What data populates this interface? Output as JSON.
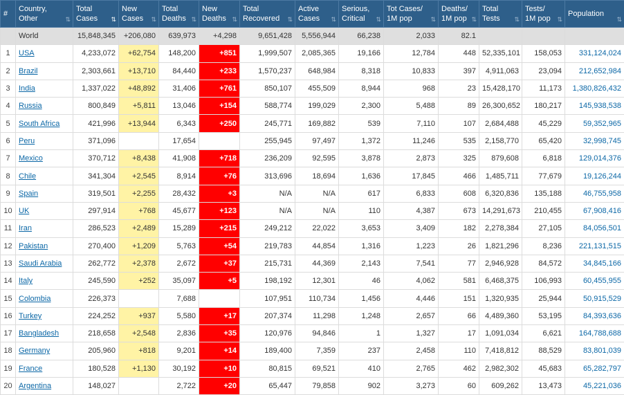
{
  "headers": [
    {
      "l1": "#",
      "l2": ""
    },
    {
      "l1": "Country,",
      "l2": "Other"
    },
    {
      "l1": "Total",
      "l2": "Cases"
    },
    {
      "l1": "New",
      "l2": "Cases"
    },
    {
      "l1": "Total",
      "l2": "Deaths"
    },
    {
      "l1": "New",
      "l2": "Deaths"
    },
    {
      "l1": "Total",
      "l2": "Recovered"
    },
    {
      "l1": "Active",
      "l2": "Cases"
    },
    {
      "l1": "Serious,",
      "l2": "Critical"
    },
    {
      "l1": "Tot Cases/",
      "l2": "1M pop"
    },
    {
      "l1": "Deaths/",
      "l2": "1M pop"
    },
    {
      "l1": "Total",
      "l2": "Tests"
    },
    {
      "l1": "Tests/",
      "l2": "1M pop"
    },
    {
      "l1": "Population",
      "l2": ""
    }
  ],
  "world": {
    "name": "World",
    "total_cases": "15,848,345",
    "new_cases": "+206,080",
    "total_deaths": "639,973",
    "new_deaths": "+4,298",
    "recovered": "9,651,428",
    "active": "5,556,944",
    "critical": "66,238",
    "cases_per_m": "2,033",
    "deaths_per_m": "82.1",
    "tests": "",
    "tests_per_m": "",
    "population": ""
  },
  "rows": [
    {
      "n": "1",
      "name": "USA",
      "total_cases": "4,233,072",
      "new_cases": "+62,754",
      "total_deaths": "148,200",
      "new_deaths": "+851",
      "recovered": "1,999,507",
      "active": "2,085,365",
      "critical": "19,166",
      "cases_per_m": "12,784",
      "deaths_per_m": "448",
      "tests": "52,335,101",
      "tests_per_m": "158,053",
      "population": "331,124,024"
    },
    {
      "n": "2",
      "name": "Brazil",
      "total_cases": "2,303,661",
      "new_cases": "+13,710",
      "total_deaths": "84,440",
      "new_deaths": "+233",
      "recovered": "1,570,237",
      "active": "648,984",
      "critical": "8,318",
      "cases_per_m": "10,833",
      "deaths_per_m": "397",
      "tests": "4,911,063",
      "tests_per_m": "23,094",
      "population": "212,652,984"
    },
    {
      "n": "3",
      "name": "India",
      "total_cases": "1,337,022",
      "new_cases": "+48,892",
      "total_deaths": "31,406",
      "new_deaths": "+761",
      "recovered": "850,107",
      "active": "455,509",
      "critical": "8,944",
      "cases_per_m": "968",
      "deaths_per_m": "23",
      "tests": "15,428,170",
      "tests_per_m": "11,173",
      "population": "1,380,826,432"
    },
    {
      "n": "4",
      "name": "Russia",
      "total_cases": "800,849",
      "new_cases": "+5,811",
      "total_deaths": "13,046",
      "new_deaths": "+154",
      "recovered": "588,774",
      "active": "199,029",
      "critical": "2,300",
      "cases_per_m": "5,488",
      "deaths_per_m": "89",
      "tests": "26,300,652",
      "tests_per_m": "180,217",
      "population": "145,938,538"
    },
    {
      "n": "5",
      "name": "South Africa",
      "total_cases": "421,996",
      "new_cases": "+13,944",
      "total_deaths": "6,343",
      "new_deaths": "+250",
      "recovered": "245,771",
      "active": "169,882",
      "critical": "539",
      "cases_per_m": "7,110",
      "deaths_per_m": "107",
      "tests": "2,684,488",
      "tests_per_m": "45,229",
      "population": "59,352,965"
    },
    {
      "n": "6",
      "name": "Peru",
      "total_cases": "371,096",
      "new_cases": "",
      "total_deaths": "17,654",
      "new_deaths": "",
      "recovered": "255,945",
      "active": "97,497",
      "critical": "1,372",
      "cases_per_m": "11,246",
      "deaths_per_m": "535",
      "tests": "2,158,770",
      "tests_per_m": "65,420",
      "population": "32,998,745"
    },
    {
      "n": "7",
      "name": "Mexico",
      "total_cases": "370,712",
      "new_cases": "+8,438",
      "total_deaths": "41,908",
      "new_deaths": "+718",
      "recovered": "236,209",
      "active": "92,595",
      "critical": "3,878",
      "cases_per_m": "2,873",
      "deaths_per_m": "325",
      "tests": "879,608",
      "tests_per_m": "6,818",
      "population": "129,014,376"
    },
    {
      "n": "8",
      "name": "Chile",
      "total_cases": "341,304",
      "new_cases": "+2,545",
      "total_deaths": "8,914",
      "new_deaths": "+76",
      "recovered": "313,696",
      "active": "18,694",
      "critical": "1,636",
      "cases_per_m": "17,845",
      "deaths_per_m": "466",
      "tests": "1,485,711",
      "tests_per_m": "77,679",
      "population": "19,126,244"
    },
    {
      "n": "9",
      "name": "Spain",
      "total_cases": "319,501",
      "new_cases": "+2,255",
      "total_deaths": "28,432",
      "new_deaths": "+3",
      "recovered": "N/A",
      "active": "N/A",
      "critical": "617",
      "cases_per_m": "6,833",
      "deaths_per_m": "608",
      "tests": "6,320,836",
      "tests_per_m": "135,188",
      "population": "46,755,958"
    },
    {
      "n": "10",
      "name": "UK",
      "total_cases": "297,914",
      "new_cases": "+768",
      "total_deaths": "45,677",
      "new_deaths": "+123",
      "recovered": "N/A",
      "active": "N/A",
      "critical": "110",
      "cases_per_m": "4,387",
      "deaths_per_m": "673",
      "tests": "14,291,673",
      "tests_per_m": "210,455",
      "population": "67,908,416"
    },
    {
      "n": "11",
      "name": "Iran",
      "total_cases": "286,523",
      "new_cases": "+2,489",
      "total_deaths": "15,289",
      "new_deaths": "+215",
      "recovered": "249,212",
      "active": "22,022",
      "critical": "3,653",
      "cases_per_m": "3,409",
      "deaths_per_m": "182",
      "tests": "2,278,384",
      "tests_per_m": "27,105",
      "population": "84,056,501"
    },
    {
      "n": "12",
      "name": "Pakistan",
      "total_cases": "270,400",
      "new_cases": "+1,209",
      "total_deaths": "5,763",
      "new_deaths": "+54",
      "recovered": "219,783",
      "active": "44,854",
      "critical": "1,316",
      "cases_per_m": "1,223",
      "deaths_per_m": "26",
      "tests": "1,821,296",
      "tests_per_m": "8,236",
      "population": "221,131,515"
    },
    {
      "n": "13",
      "name": "Saudi Arabia",
      "total_cases": "262,772",
      "new_cases": "+2,378",
      "total_deaths": "2,672",
      "new_deaths": "+37",
      "recovered": "215,731",
      "active": "44,369",
      "critical": "2,143",
      "cases_per_m": "7,541",
      "deaths_per_m": "77",
      "tests": "2,946,928",
      "tests_per_m": "84,572",
      "population": "34,845,166"
    },
    {
      "n": "14",
      "name": "Italy",
      "total_cases": "245,590",
      "new_cases": "+252",
      "total_deaths": "35,097",
      "new_deaths": "+5",
      "recovered": "198,192",
      "active": "12,301",
      "critical": "46",
      "cases_per_m": "4,062",
      "deaths_per_m": "581",
      "tests": "6,468,375",
      "tests_per_m": "106,993",
      "population": "60,455,955"
    },
    {
      "n": "15",
      "name": "Colombia",
      "total_cases": "226,373",
      "new_cases": "",
      "total_deaths": "7,688",
      "new_deaths": "",
      "recovered": "107,951",
      "active": "110,734",
      "critical": "1,456",
      "cases_per_m": "4,446",
      "deaths_per_m": "151",
      "tests": "1,320,935",
      "tests_per_m": "25,944",
      "population": "50,915,529"
    },
    {
      "n": "16",
      "name": "Turkey",
      "total_cases": "224,252",
      "new_cases": "+937",
      "total_deaths": "5,580",
      "new_deaths": "+17",
      "recovered": "207,374",
      "active": "11,298",
      "critical": "1,248",
      "cases_per_m": "2,657",
      "deaths_per_m": "66",
      "tests": "4,489,360",
      "tests_per_m": "53,195",
      "population": "84,393,636"
    },
    {
      "n": "17",
      "name": "Bangladesh",
      "total_cases": "218,658",
      "new_cases": "+2,548",
      "total_deaths": "2,836",
      "new_deaths": "+35",
      "recovered": "120,976",
      "active": "94,846",
      "critical": "1",
      "cases_per_m": "1,327",
      "deaths_per_m": "17",
      "tests": "1,091,034",
      "tests_per_m": "6,621",
      "population": "164,788,688"
    },
    {
      "n": "18",
      "name": "Germany",
      "total_cases": "205,960",
      "new_cases": "+818",
      "total_deaths": "9,201",
      "new_deaths": "+14",
      "recovered": "189,400",
      "active": "7,359",
      "critical": "237",
      "cases_per_m": "2,458",
      "deaths_per_m": "110",
      "tests": "7,418,812",
      "tests_per_m": "88,529",
      "population": "83,801,039"
    },
    {
      "n": "19",
      "name": "France",
      "total_cases": "180,528",
      "new_cases": "+1,130",
      "total_deaths": "30,192",
      "new_deaths": "+10",
      "recovered": "80,815",
      "active": "69,521",
      "critical": "410",
      "cases_per_m": "2,765",
      "deaths_per_m": "462",
      "tests": "2,982,302",
      "tests_per_m": "45,683",
      "population": "65,282,797"
    },
    {
      "n": "20",
      "name": "Argentina",
      "total_cases": "148,027",
      "new_cases": "",
      "total_deaths": "2,722",
      "new_deaths": "+20",
      "recovered": "65,447",
      "active": "79,858",
      "critical": "902",
      "cases_per_m": "3,273",
      "deaths_per_m": "60",
      "tests": "609,262",
      "tests_per_m": "13,473",
      "population": "45,221,036"
    }
  ]
}
